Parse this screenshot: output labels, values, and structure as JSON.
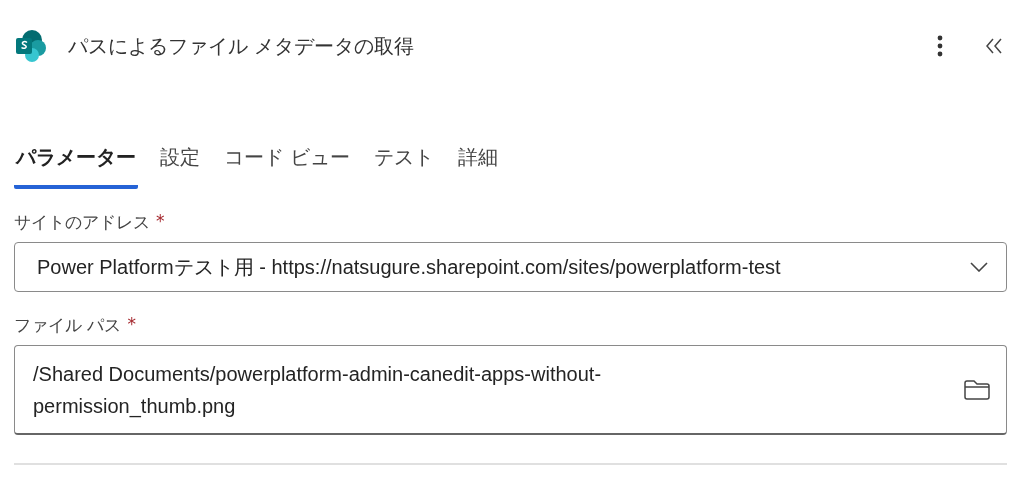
{
  "header": {
    "title": "パスによるファイル メタデータの取得"
  },
  "tabs": [
    {
      "label": "パラメーター",
      "selected": true
    },
    {
      "label": "設定",
      "selected": false
    },
    {
      "label": "コード ビュー",
      "selected": false
    },
    {
      "label": "テスト",
      "selected": false
    },
    {
      "label": "詳細",
      "selected": false
    }
  ],
  "fields": [
    {
      "kind": "dropdown",
      "label": "サイトのアドレス",
      "required_mark": "*",
      "value": "Power Platformテスト用 - https://natsugure.sharepoint.com/sites/powerplatform-test"
    },
    {
      "kind": "file",
      "label": "ファイル パス",
      "required_mark": "*",
      "value": "/Shared Documents/powerplatform-admin-canedit-apps-without-permission_thumb.png"
    }
  ]
}
